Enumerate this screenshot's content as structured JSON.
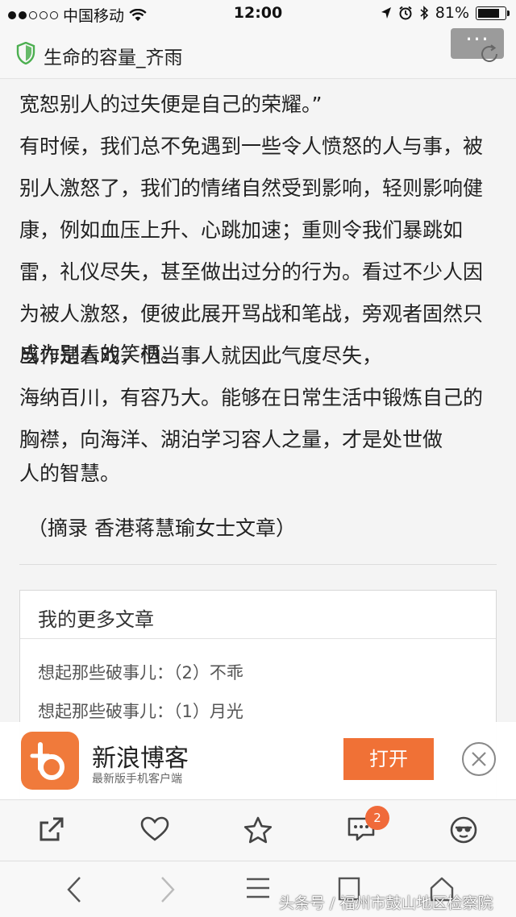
{
  "status_bar": {
    "carrier": "中国移动",
    "time": "12:00",
    "battery": "81%",
    "battery_level": 0.81
  },
  "header": {
    "title": "生命的容量_齐雨",
    "more_label": "···"
  },
  "article": {
    "paragraphs": [
      "宽恕别人的过失便是自己的荣耀。”",
      "有时候，我们总不免遇到一些令人愤怒的人与事，被别人激怒了，我们的情绪自然受到影响，轻则影响健康，例如血压上升、心跳加速；重则令我们暴跳如雷，礼仪尽失，甚至做出过分的行为。看过不少人因为被人激怒，便彼此展开骂战和笔战，旁观者固然只当作是看戏，但当事人就因此气度尽失，",
      "成为别人的笑柄。",
      "海纳百川，有容乃大。能够在日常生活中锻炼自己的胸襟，向海洋、湖泊学习容人之量，才是处世做",
      "人的智慧。"
    ],
    "source": "（摘录 香港蒋慧瑜女士文章）"
  },
  "more_articles": {
    "heading": "我的更多文章",
    "items": [
      "想起那些破事儿：（2）不乖",
      "想起那些破事儿：（1）月光"
    ]
  },
  "promo": {
    "app_name": "新浪博客",
    "subtitle": "最新版手机客户端",
    "open_label": "打开"
  },
  "actions": {
    "comment_count": "2"
  },
  "watermark": "头条号 / 福州市鼓山地区检察院",
  "colors": {
    "accent": "#f07136",
    "shield": "#4caf50"
  }
}
